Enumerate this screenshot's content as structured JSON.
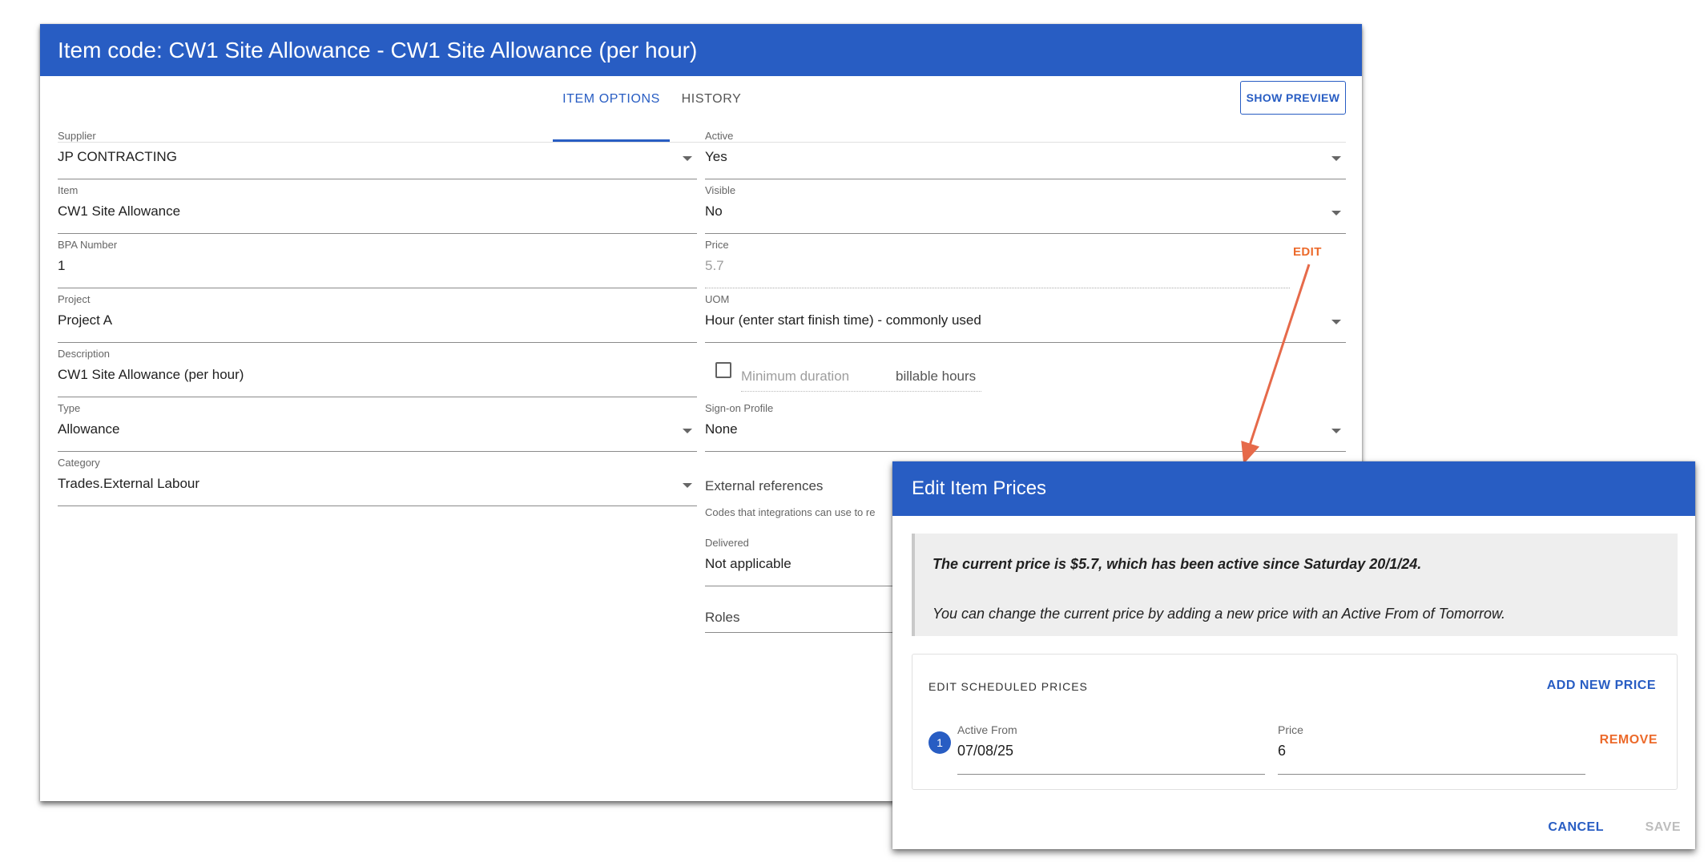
{
  "header": {
    "title": "Item code: CW1 Site Allowance - CW1 Site Allowance (per hour)"
  },
  "tabs": [
    {
      "label": "ITEM OPTIONS"
    },
    {
      "label": "HISTORY"
    }
  ],
  "show_preview_label": "SHOW PREVIEW",
  "left_fields": {
    "supplier": {
      "label": "Supplier",
      "value": "JP CONTRACTING"
    },
    "item": {
      "label": "Item",
      "value": "CW1 Site Allowance"
    },
    "bpa": {
      "label": "BPA Number",
      "value": "1"
    },
    "project": {
      "label": "Project",
      "value": "Project A"
    },
    "description": {
      "label": "Description",
      "value": "CW1 Site Allowance (per hour)"
    },
    "type": {
      "label": "Type",
      "value": "Allowance"
    },
    "category": {
      "label": "Category",
      "value": "Trades.External Labour"
    }
  },
  "right_fields": {
    "active": {
      "label": "Active",
      "value": "Yes"
    },
    "visible": {
      "label": "Visible",
      "value": "No"
    },
    "price": {
      "label": "Price",
      "value": "5.7"
    },
    "edit_label": "EDIT",
    "uom": {
      "label": "UOM",
      "value": "Hour (enter start finish time) - commonly used"
    },
    "min_duration_placeholder": "Minimum duration",
    "billable_hours": "billable hours",
    "signon": {
      "label": "Sign-on Profile",
      "value": "None"
    },
    "external_refs_title": "External references",
    "external_refs_help": "Codes that integrations can use to re",
    "delivered": {
      "label": "Delivered",
      "value": "Not applicable"
    },
    "roles": "Roles"
  },
  "dialog": {
    "title": "Edit Item Prices",
    "notice_bold": "The current price is $5.7, which has been active since Saturday 20/1/24.",
    "notice_text": "You can change the current price by adding a new price with an Active From of Tomorrow.",
    "scheduled_title": "EDIT SCHEDULED PRICES",
    "add_new_price": "ADD NEW PRICE",
    "rows": [
      {
        "index": "1",
        "active_from_label": "Active From",
        "active_from": "07/08/25",
        "price_label": "Price",
        "price": "6",
        "remove_label": "REMOVE"
      }
    ],
    "cancel": "CANCEL",
    "save": "SAVE"
  },
  "colors": {
    "primary": "#285dc3",
    "accent": "#ec6a2b"
  }
}
